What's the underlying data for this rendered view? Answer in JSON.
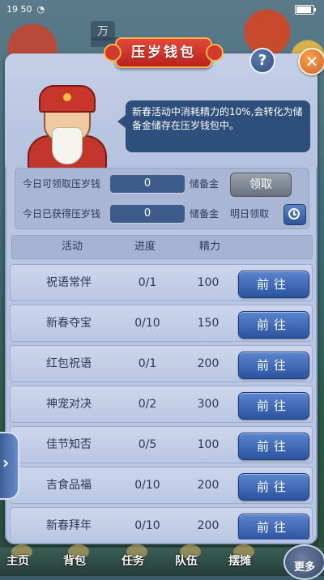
{
  "status_bar": {
    "time": "19 50"
  },
  "background": {
    "top_text": "万"
  },
  "dialog": {
    "title": "压岁钱包",
    "help_label": "?",
    "close_label": "✕",
    "speech": "新春活动中消耗精力的10%,会转化为储备金储存在压岁钱包中。"
  },
  "info": {
    "row1": {
      "label": "今日可领取压岁钱",
      "value": "0",
      "label2": "储备金",
      "button": "领取"
    },
    "row2": {
      "label": "今日已获得压岁钱",
      "value": "0",
      "label2": "储备金",
      "tomorrow": "明日领取"
    }
  },
  "table": {
    "headers": [
      "活动",
      "进度",
      "精力"
    ],
    "go_label": "前往",
    "rows": [
      {
        "name": "祝语常伴",
        "progress": "0/1",
        "energy": "100"
      },
      {
        "name": "新春夺宝",
        "progress": "0/10",
        "energy": "150"
      },
      {
        "name": "红包祝语",
        "progress": "0/1",
        "energy": "200"
      },
      {
        "name": "神宠对决",
        "progress": "0/2",
        "energy": "300"
      },
      {
        "name": "佳节知否",
        "progress": "0/5",
        "energy": "100"
      },
      {
        "name": "吉食品福",
        "progress": "0/10",
        "energy": "200"
      },
      {
        "name": "新春拜年",
        "progress": "0/10",
        "energy": "200"
      }
    ]
  },
  "side_tab": {
    "label": "›"
  },
  "bottom_bar": {
    "items": [
      "主页",
      "背包",
      "任务",
      "队伍",
      "摆摊"
    ],
    "more": "更多"
  },
  "colors": {
    "title_red": "#c8352a",
    "go_button": "#2a549e",
    "panel": "#b9c5e1"
  }
}
